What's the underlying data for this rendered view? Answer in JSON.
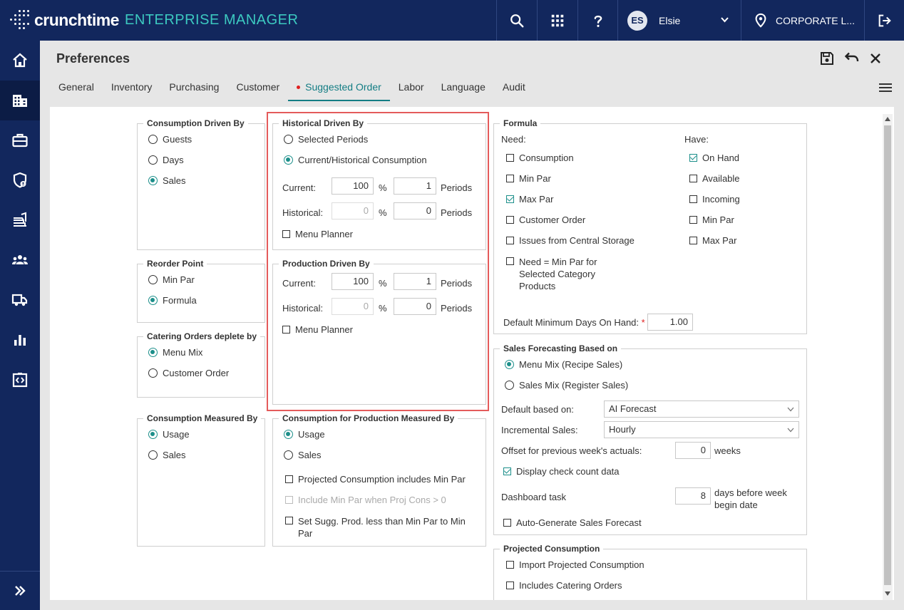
{
  "topbar": {
    "brand": "crunchtime",
    "product": "ENTERPRISE MANAGER",
    "avatar_initials": "ES",
    "user_name": "Elsie",
    "location": "CORPORATE L...",
    "icons": [
      "search-icon",
      "grid-icon",
      "help-icon",
      "chevron-down-icon",
      "location-pin-icon",
      "logout-icon"
    ]
  },
  "leftnav": {
    "items": [
      "home-icon",
      "building-icon",
      "briefcase-icon",
      "shield-icon",
      "inventory-icon",
      "people-icon",
      "truck-icon",
      "bar-chart-icon",
      "code-icon"
    ],
    "expand_icon": "double-chevron-right-icon"
  },
  "header": {
    "title": "Preferences",
    "tabs": [
      "General",
      "Inventory",
      "Purchasing",
      "Customer",
      "Suggested Order",
      "Labor",
      "Language",
      "Audit"
    ],
    "active_tab": "Suggested Order"
  },
  "consumption_driven_by": {
    "legend": "Consumption Driven By",
    "options": [
      "Guests",
      "Days",
      "Sales"
    ],
    "selected": "Sales"
  },
  "reorder_point": {
    "legend": "Reorder Point",
    "options": [
      "Min Par",
      "Formula"
    ],
    "selected": "Formula"
  },
  "catering_orders": {
    "legend": "Catering Orders deplete by",
    "options": [
      "Menu Mix",
      "Customer Order"
    ],
    "selected": "Menu Mix"
  },
  "consumption_measured_by": {
    "legend": "Consumption Measured By",
    "options": [
      "Usage",
      "Sales"
    ],
    "selected": "Usage"
  },
  "historical_driven_by": {
    "legend": "Historical Driven By",
    "options": [
      "Selected Periods",
      "Current/Historical Consumption"
    ],
    "selected": "Current/Historical Consumption",
    "current_label": "Current:",
    "current_pct": "100",
    "current_periods": "1",
    "historical_label": "Historical:",
    "historical_pct": "0",
    "historical_periods": "0",
    "pct_symbol": "%",
    "periods_label": "Periods",
    "menu_planner": "Menu Planner"
  },
  "production_driven_by": {
    "legend": "Production Driven By",
    "current_label": "Current:",
    "current_pct": "100",
    "current_periods": "1",
    "historical_label": "Historical:",
    "historical_pct": "0",
    "historical_periods": "0",
    "pct_symbol": "%",
    "periods_label": "Periods",
    "menu_planner": "Menu Planner"
  },
  "production_measured_by": {
    "legend": "Consumption for Production Measured By",
    "options": [
      "Usage",
      "Sales"
    ],
    "selected": "Usage",
    "projected_includes_min_par": "Projected Consumption includes Min Par",
    "include_min_par": "Include Min Par when Proj Cons > 0",
    "set_sugg_prod": "Set Sugg. Prod. less than Min Par to Min Par"
  },
  "formula": {
    "legend": "Formula",
    "need_label": "Need:",
    "have_label": "Have:",
    "need": [
      {
        "label": "Consumption",
        "checked": false
      },
      {
        "label": "Min Par",
        "checked": false
      },
      {
        "label": "Max Par",
        "checked": true
      },
      {
        "label": "Customer Order",
        "checked": false
      },
      {
        "label": "Issues from Central Storage",
        "checked": false
      },
      {
        "label": "Need = Min Par for Selected Category Products",
        "checked": false
      }
    ],
    "have": [
      {
        "label": "On Hand",
        "checked": true
      },
      {
        "label": "Available",
        "checked": false
      },
      {
        "label": "Incoming",
        "checked": false
      },
      {
        "label": "Min Par",
        "checked": false
      },
      {
        "label": "Max Par",
        "checked": false
      }
    ],
    "default_min_days_label": "Default Minimum Days On Hand:",
    "required_mark": "*",
    "default_min_days_value": "1.00"
  },
  "sales_forecasting": {
    "legend": "Sales Forecasting Based on",
    "options": [
      "Menu Mix (Recipe Sales)",
      "Sales Mix (Register Sales)"
    ],
    "selected": "Menu Mix (Recipe Sales)",
    "default_based_on_label": "Default based on:",
    "default_based_on_value": "AI Forecast",
    "incremental_label": "Incremental Sales:",
    "incremental_value": "Hourly",
    "offset_label": "Offset for previous week's actuals:",
    "offset_value": "0",
    "offset_unit": "weeks",
    "display_check_count": "Display check count data",
    "dashboard_task_label": "Dashboard task",
    "dashboard_task_value": "8",
    "dashboard_task_unit": "days before week begin date",
    "auto_generate": "Auto-Generate Sales Forecast"
  },
  "projected_consumption": {
    "legend": "Projected Consumption",
    "import": "Import Projected Consumption",
    "catering": "Includes Catering Orders"
  }
}
